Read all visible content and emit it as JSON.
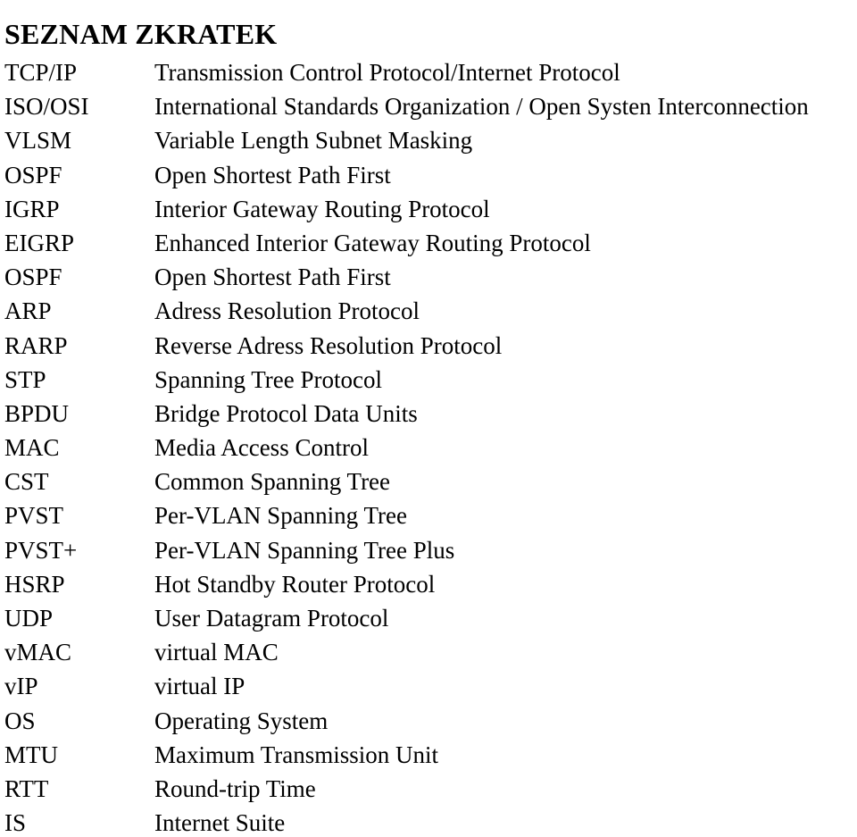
{
  "document": {
    "title": "SEZNAM ZKRATEK"
  },
  "abbreviations": [
    {
      "term": "TCP/IP",
      "definition": "Transmission Control Protocol/Internet Protocol"
    },
    {
      "term": "ISO/OSI",
      "definition": "International Standards Organization / Open Systen Interconnection"
    },
    {
      "term": "VLSM",
      "definition": "Variable Length Subnet Masking"
    },
    {
      "term": "OSPF",
      "definition": "Open Shortest Path First"
    },
    {
      "term": "IGRP",
      "definition": "Interior Gateway Routing Protocol"
    },
    {
      "term": "EIGRP",
      "definition": "Enhanced Interior Gateway Routing Protocol"
    },
    {
      "term": "OSPF",
      "definition": "Open Shortest Path First"
    },
    {
      "term": "ARP",
      "definition": "Adress Resolution Protocol"
    },
    {
      "term": "RARP",
      "definition": "Reverse Adress Resolution Protocol"
    },
    {
      "term": "STP",
      "definition": "Spanning Tree Protocol"
    },
    {
      "term": "BPDU",
      "definition": "Bridge Protocol Data Units"
    },
    {
      "term": "MAC",
      "definition": "Media Access Control"
    },
    {
      "term": "CST",
      "definition": "Common Spanning Tree"
    },
    {
      "term": "PVST",
      "definition": "Per-VLAN Spanning Tree"
    },
    {
      "term": "PVST+",
      "definition": "Per-VLAN Spanning Tree Plus"
    },
    {
      "term": "HSRP",
      "definition": "Hot Standby Router Protocol"
    },
    {
      "term": "UDP",
      "definition": "User Datagram Protocol"
    },
    {
      "term": "vMAC",
      "definition": "virtual MAC"
    },
    {
      "term": "vIP",
      "definition": "virtual IP"
    },
    {
      "term": "OS",
      "definition": "Operating System"
    },
    {
      "term": "MTU",
      "definition": "Maximum Transmission Unit"
    },
    {
      "term": "RTT",
      "definition": "Round-trip Time"
    },
    {
      "term": "IS",
      "definition": "Internet Suite"
    }
  ]
}
